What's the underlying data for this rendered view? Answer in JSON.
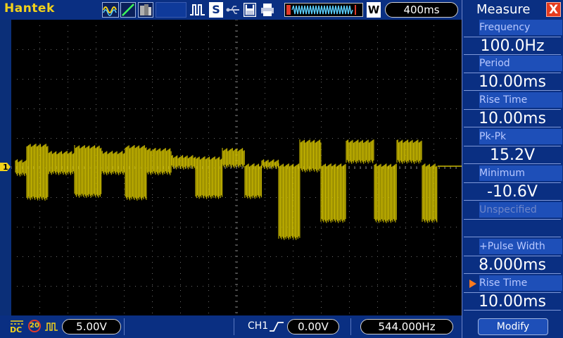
{
  "top_bar": {
    "brand": "Hantek",
    "s_label": "S",
    "w_label": "W",
    "timebase": "400ms"
  },
  "bottom_bar": {
    "coupling": "DC",
    "bandwidth_limit": "20",
    "volts_div": "5.00V",
    "trigger_source": "CH1",
    "trigger_level": "0.00V",
    "frequency_counter": "544.000Hz"
  },
  "channel_marker": "1",
  "measure": {
    "title": "Measure",
    "close_label": "X",
    "items": [
      {
        "label": "Frequency",
        "value": "100.0Hz"
      },
      {
        "label": "Period",
        "value": "10.00ms"
      },
      {
        "label": "Rise Time",
        "value": "10.00ms"
      },
      {
        "label": "Pk-Pk",
        "value": "15.2V"
      },
      {
        "label": "Minimum",
        "value": "-10.6V"
      },
      {
        "label": "Unspecified",
        "value": ""
      },
      {
        "label": "+Pulse Width",
        "value": "8.000ms"
      },
      {
        "label": "Rise Time",
        "value": "10.00ms"
      }
    ],
    "modify_label": "Modify"
  },
  "colors": {
    "trace": "#c8b800",
    "brand": "#f2d21a",
    "panel": "#0a2f82",
    "close": "#e53b1e",
    "selected_arrow": "#ff7a1e"
  },
  "icons": [
    "waveform-icon",
    "slope-icon",
    "persistence-icon",
    "pulse-icon",
    "usb-icon",
    "save-icon",
    "printer-icon",
    "trigger-rising-edge-icon",
    "channel-marker-icon"
  ]
}
